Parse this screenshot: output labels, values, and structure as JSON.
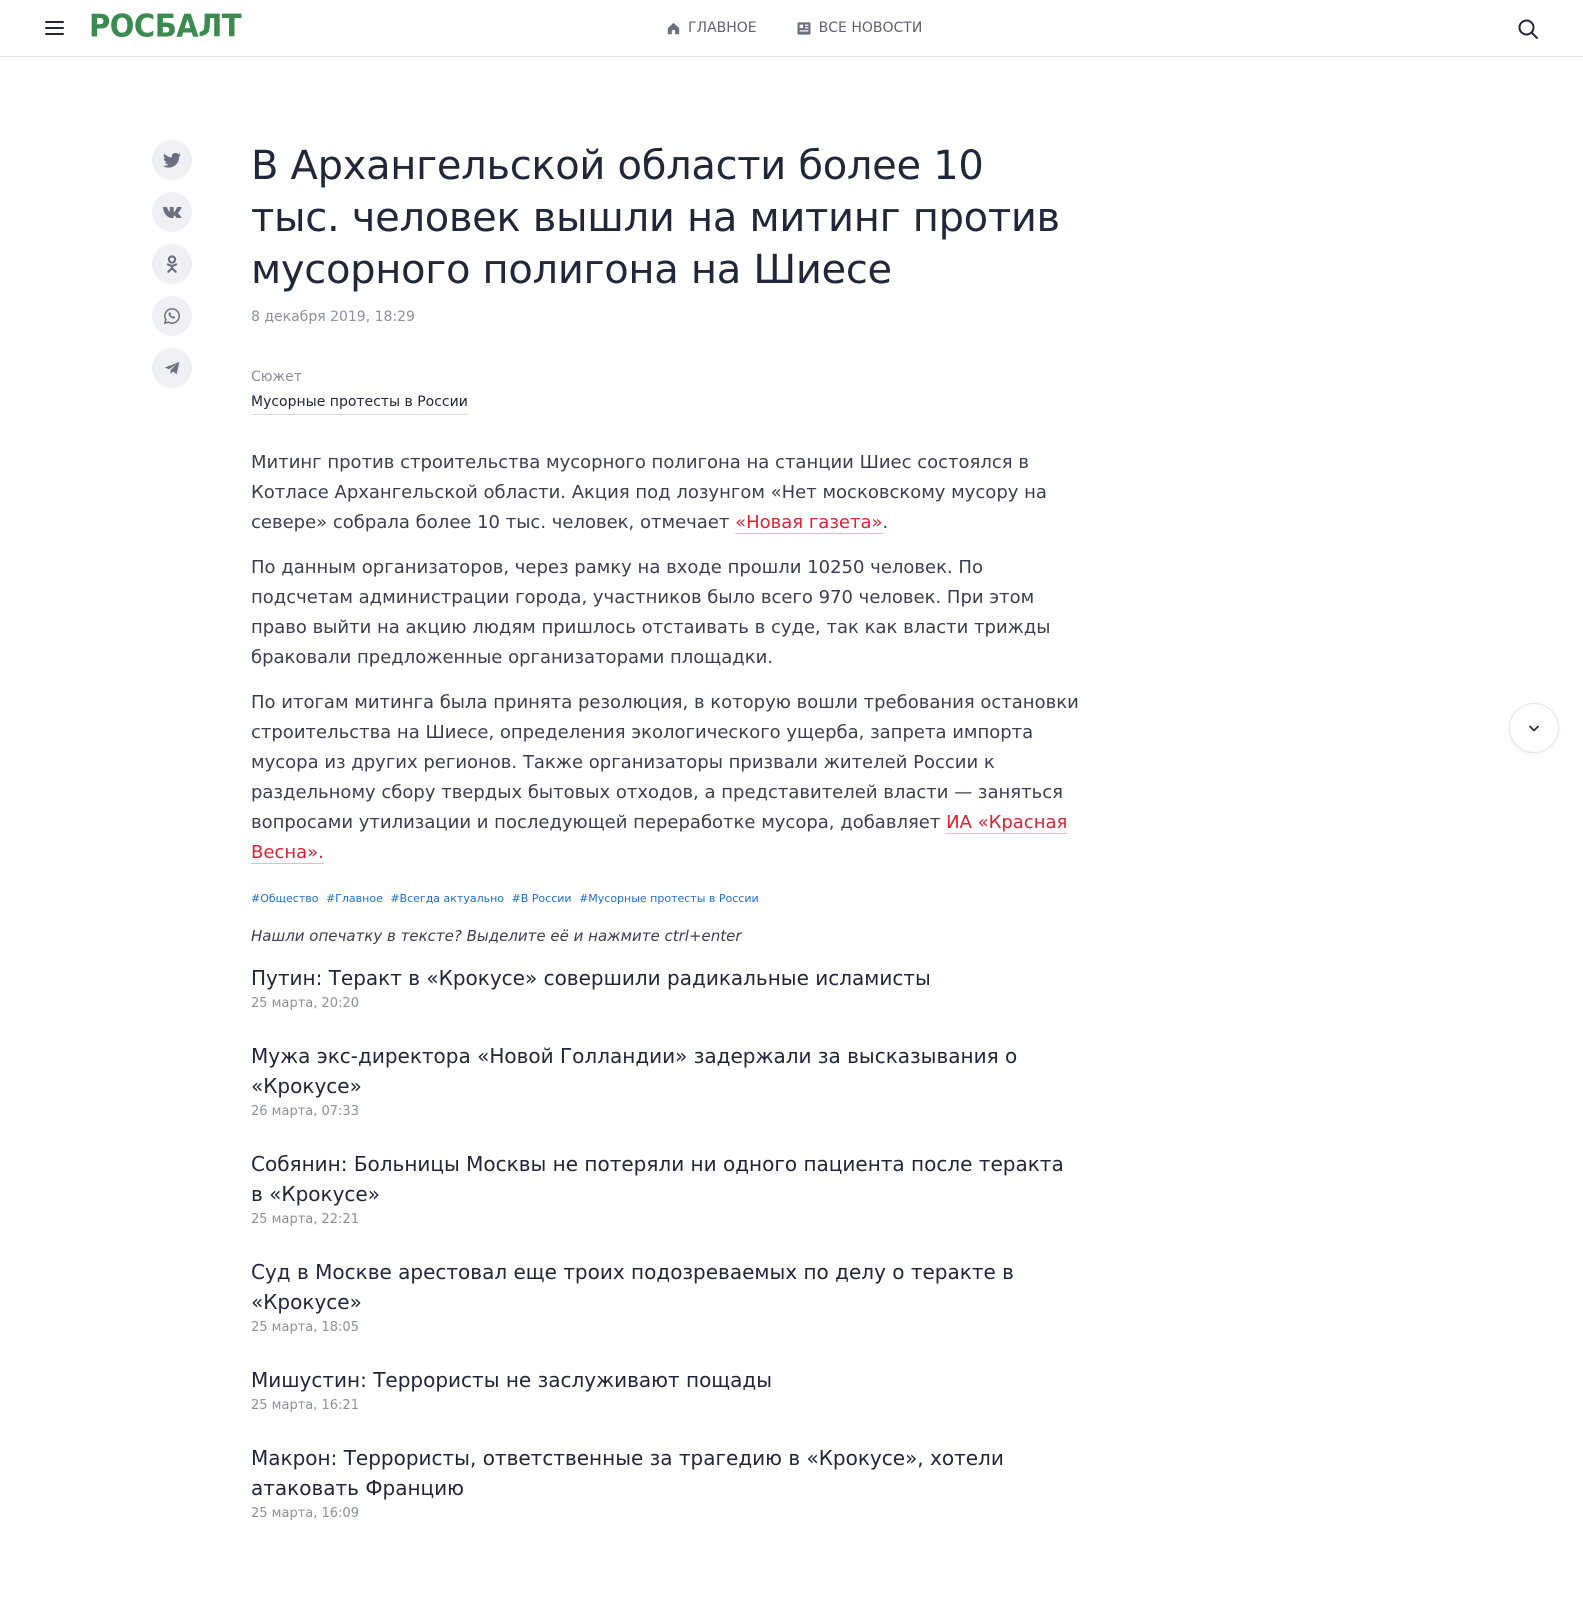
{
  "header": {
    "logo": "РОСБАЛТ",
    "nav": [
      {
        "label": "ГЛАВНОЕ",
        "icon": "home-icon"
      },
      {
        "label": "ВСЕ НОВОСТИ",
        "icon": "newspaper-icon"
      }
    ]
  },
  "share": [
    "twitter-icon",
    "vk-icon",
    "odnoklassniki-icon",
    "whatsapp-icon",
    "telegram-icon"
  ],
  "article": {
    "title": "В Архангельской области более 10 тыс. человек вышли на митинг против мусорного полигона на Шиесе",
    "date": "8 декабря 2019, 18:29",
    "story_label": "Сюжет",
    "story_link": "Мусорные протесты в России",
    "p1_text": "Митинг против строительства мусорного полигона на станции Шиес состоялся в Котласе Архангельской области. Акция под лозунгом «Нет московскому мусору на севере» собрала более 10 тыс. человек, отмечает ",
    "p1_link": "«Новая газета»",
    "p1_end": ".",
    "p2": "По данным организаторов, через рамку на входе прошли 10250 человек. По подсчетам администрации города, участников было всего 970 человек. При этом право выйти на акцию людям пришлось отстаивать в суде, так как власти трижды браковали предложенные организаторами площадки.",
    "p3_text": "По итогам митинга была принята резолюция, в которую вошли требования остановки строительства на Шиесе, определения экологического ущерба, запрета импорта мусора из других регионов. Также организаторы призвали жителей России к раздельному сбору твердых бытовых отходов, а представителей власти — заняться вопросами утилизации и последующей переработке мусора, добавляет ",
    "p3_link": "ИА «Красная Весна».",
    "tags": [
      "#Общество",
      "#Главное",
      "#Всегда актуально",
      "#В России",
      "#Мусорные протесты в России"
    ],
    "typo_note": "Нашли опечатку в тексте? Выделите её и нажмите ctrl+enter"
  },
  "related": [
    {
      "title": "Путин: Теракт в «Крокусе» совершили радикальные исламисты",
      "date": "25 марта, 20:20"
    },
    {
      "title": "Мужа экс-директора «Новой Голландии» задержали за высказывания о «Крокусе»",
      "date": "26 марта, 07:33"
    },
    {
      "title": "Собянин: Больницы Москвы не потеряли ни одного пациента после теракта в «Крокусе»",
      "date": "25 марта, 22:21"
    },
    {
      "title": "Суд в Москве арестовал еще троих подозреваемых по делу о теракте в «Крокусе»",
      "date": "25 марта, 18:05"
    },
    {
      "title": "Мишустин: Террористы не заслуживают пощады",
      "date": "25 марта, 16:21"
    },
    {
      "title": "Макрон: Террористы, ответственные за трагедию в «Крокусе», хотели атаковать Францию",
      "date": "25 марта, 16:09"
    }
  ],
  "colors": {
    "brand": "#3b8a4f",
    "link": "#e21f33",
    "tag": "#1e6fd9"
  }
}
